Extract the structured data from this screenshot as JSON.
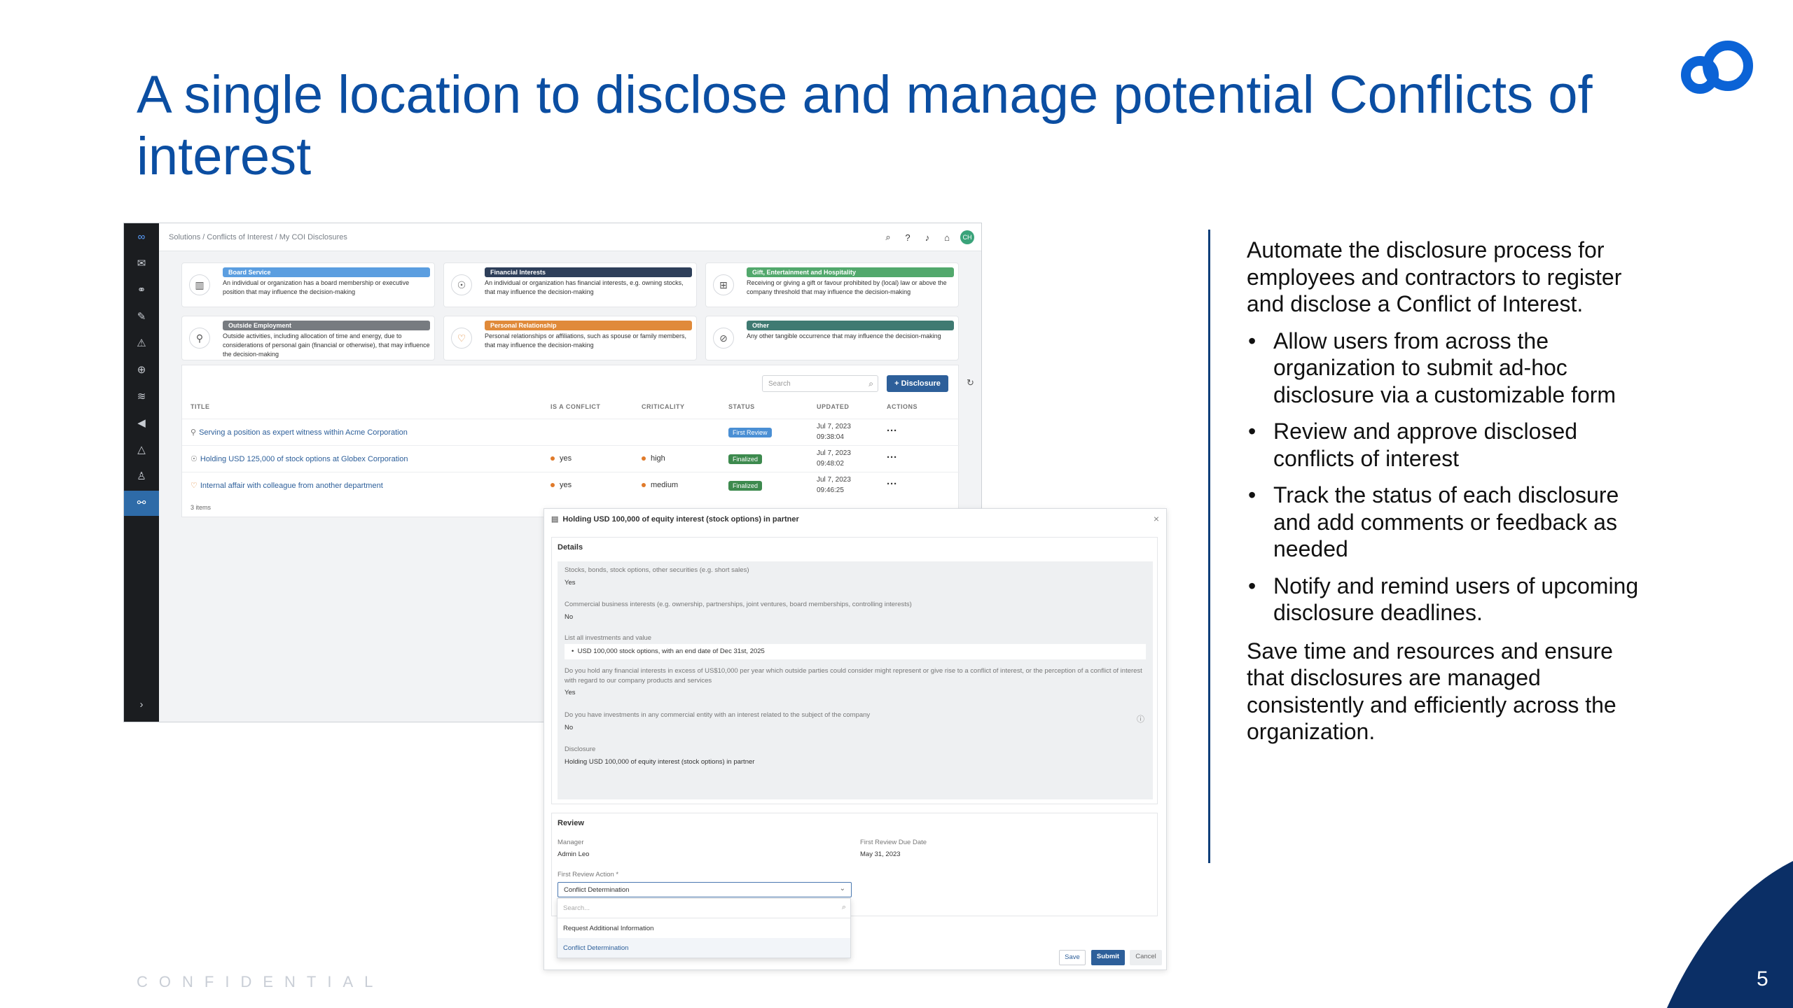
{
  "slide": {
    "title": "A single location to disclose and manage potential Conflicts of interest",
    "intro": "Automate the disclosure process for employees and contractors to register and disclose a Conflict of Interest.",
    "bullets": [
      "Allow users from across the organization to submit ad-hoc disclosure via a customizable form",
      "Review and approve disclosed conflicts of interest",
      "Track the status of each disclosure and add comments or feedback as needed",
      "Notify and remind users of upcoming disclosure deadlines."
    ],
    "closing": "Save time and resources and ensure that disclosures are managed consistently and efficiently across the organization.",
    "confidential": "CONFIDENTIAL",
    "page_number": "5",
    "colors": {
      "title": "#0b4ea2",
      "brand": "#0b63d6",
      "corner": "#0b2f66"
    }
  },
  "app": {
    "breadcrumb": "Solutions / Conflicts of Interest / My COI Disclosures",
    "avatar": "CH",
    "sidebar_icons": [
      "logo-icon",
      "mail-icon",
      "link-icon",
      "pen-icon",
      "warning-icon",
      "globe-icon",
      "stack-icon",
      "megaphone-icon",
      "alert-icon",
      "person-icon",
      "handshake-icon"
    ],
    "categories": [
      {
        "tag": "Board Service",
        "tag_color": "#5b9ee0",
        "icon": "building-icon",
        "desc": "An individual or organization has a board membership or executive position that may influence the decision-making"
      },
      {
        "tag": "Financial Interests",
        "tag_color": "#2e3f5a",
        "icon": "medal-icon",
        "desc": "An individual or organization has financial interests, e.g. owning stocks, that may influence the decision-making"
      },
      {
        "tag": "Gift, Entertainment and Hospitality",
        "tag_color": "#52a86c",
        "icon": "gift-icon",
        "desc": "Receiving or giving a gift or favour prohibited by (local) law or above the company threshold that may influence the decision-making"
      },
      {
        "tag": "Outside Employment",
        "tag_color": "#777b80",
        "icon": "employment-icon",
        "desc": "Outside activities, including allocation of time and energy, due to considerations of personal gain (financial or otherwise), that may influence the decision-making"
      },
      {
        "tag": "Personal Relationship",
        "tag_color": "#e08a3a",
        "icon": "heart-icon",
        "desc": "Personal relationships or affiliations, such as spouse or family members, that may influence the decision-making"
      },
      {
        "tag": "Other",
        "tag_color": "#3f7a72",
        "icon": "other-icon",
        "desc": "Any other tangible occurrence that may influence the decision-making"
      }
    ],
    "search_placeholder": "Search",
    "disclosure_button": "+ Disclosure",
    "columns": [
      "TITLE",
      "IS A CONFLICT",
      "CRITICALITY",
      "STATUS",
      "UPDATED",
      "ACTIONS"
    ],
    "rows": [
      {
        "title": "Serving a position as expert witness within Acme Corporation",
        "conflict": "",
        "criticality": "",
        "status": "First Review",
        "status_color": "#4a8fd4",
        "updated_date": "Jul 7, 2023",
        "updated_time": "09:38:04"
      },
      {
        "title": "Holding USD 125,000 of stock options at Globex Corporation",
        "conflict": "yes",
        "criticality": "high",
        "status": "Finalized",
        "status_color": "#3d8a4e",
        "updated_date": "Jul 7, 2023",
        "updated_time": "09:48:02"
      },
      {
        "title": "Internal affair with colleague from another department",
        "conflict": "yes",
        "criticality": "medium",
        "status": "Finalized",
        "status_color": "#3d8a4e",
        "updated_date": "Jul 7, 2023",
        "updated_time": "09:46:25"
      }
    ],
    "items_count": "3 items"
  },
  "modal": {
    "title": "Holding USD 100,000 of equity interest (stock options) in partner",
    "details_heading": "Details",
    "q1": "Stocks, bonds, stock options, other securities (e.g. short sales)",
    "a1": "Yes",
    "q2": "Commercial business interests (e.g. ownership, partnerships, joint ventures, board memberships, controlling interests)",
    "a2": "No",
    "q3": "List all investments and value",
    "a3": "USD 100,000 stock options, with an end date of Dec 31st, 2025",
    "q4": "Do you hold any financial interests in excess of US$10,000 per year which outside parties could consider might represent or give rise to a conflict of interest, or the perception of a conflict of interest with regard to our company products and services",
    "a4": "Yes",
    "q5": "Do you have investments in any commercial entity with an interest related to the subject of the company",
    "a5": "No",
    "q6": "Disclosure",
    "a6": "Holding USD 100,000 of equity interest (stock options) in partner",
    "review_heading": "Review",
    "manager_label": "Manager",
    "manager_value": "Admin Leo",
    "due_label": "First Review Due Date",
    "due_value": "May 31, 2023",
    "action_label": "First Review Action *",
    "action_value": "Conflict Determination",
    "dropdown_search": "Search...",
    "options": [
      "Request Additional Information",
      "Conflict Determination"
    ],
    "save": "Save",
    "submit": "Submit",
    "cancel": "Cancel"
  }
}
